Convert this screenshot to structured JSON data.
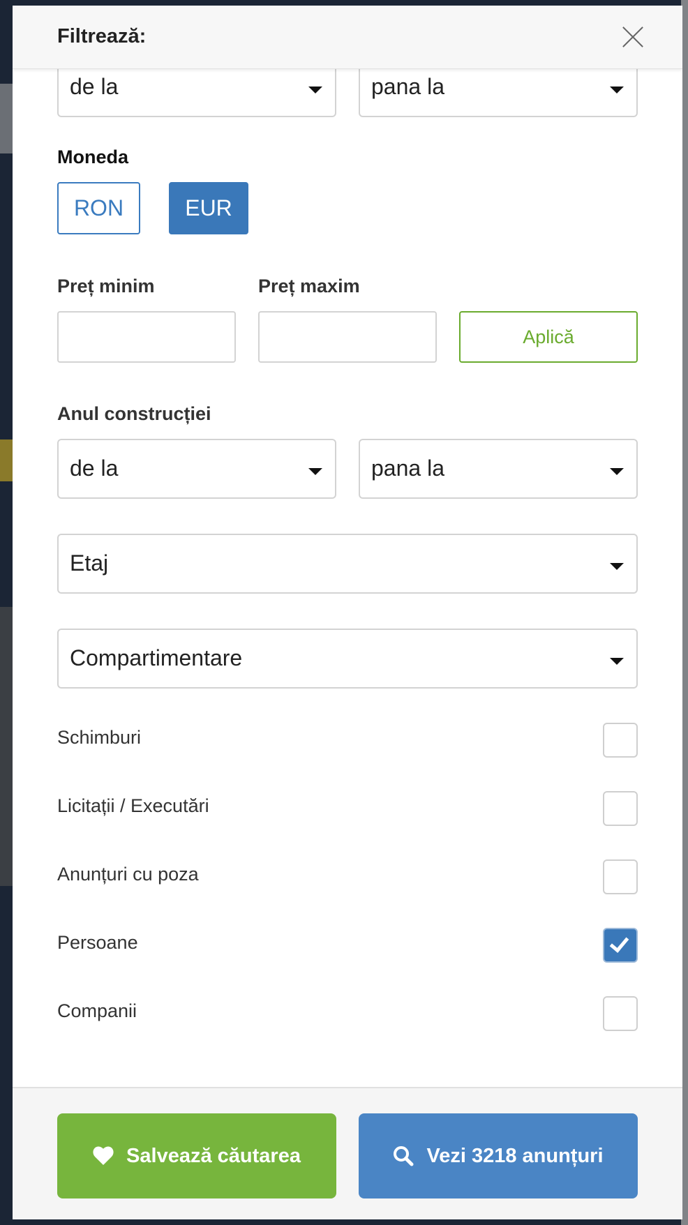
{
  "header": {
    "title": "Filtrează:"
  },
  "surface": {
    "from_placeholder": "de la",
    "to_placeholder": "pana la"
  },
  "currency": {
    "label": "Moneda",
    "options": [
      "RON",
      "EUR"
    ],
    "selected": "EUR"
  },
  "price": {
    "min_label": "Preț minim",
    "max_label": "Preț maxim",
    "min_value": "",
    "max_value": "",
    "apply_label": "Aplică"
  },
  "construction_year": {
    "label": "Anul construcției",
    "from_placeholder": "de la",
    "to_placeholder": "pana la"
  },
  "floor": {
    "placeholder": "Etaj"
  },
  "layout_type": {
    "placeholder": "Compartimentare"
  },
  "checkboxes": [
    {
      "label": "Schimburi",
      "checked": false
    },
    {
      "label": "Licitații / Executări",
      "checked": false
    },
    {
      "label": "Anunțuri cu poza",
      "checked": false
    },
    {
      "label": "Persoane",
      "checked": true
    },
    {
      "label": "Companii",
      "checked": false
    }
  ],
  "footer": {
    "save_label": "Salvează căutarea",
    "view_label": "Vezi 3218 anunțuri"
  },
  "colors": {
    "primary_blue": "#3a78b9",
    "green": "#77b53d",
    "apply_green": "#6aab2e"
  }
}
